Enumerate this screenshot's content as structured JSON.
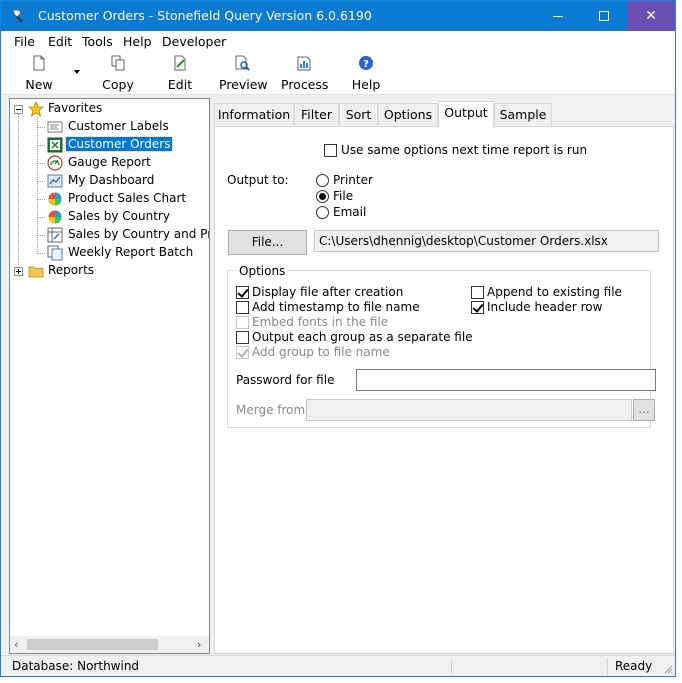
{
  "window": {
    "title": "Customer Orders - Stonefield Query Version 6.0.6190",
    "min_icon": "minimize-icon",
    "max_icon": "maximize-icon",
    "close_icon": "close-icon",
    "close_glyph": "✕"
  },
  "menu": [
    "File",
    "Edit",
    "Tools",
    "Help",
    "Developer"
  ],
  "toolbar": {
    "new": "New",
    "copy": "Copy",
    "edit": "Edit",
    "preview": "Preview",
    "process": "Process",
    "help": "Help"
  },
  "tree": {
    "favorites_label": "Favorites",
    "items": [
      {
        "label": "Customer Labels",
        "icon": "labels-report-icon"
      },
      {
        "label": "Customer Orders",
        "icon": "excel-report-icon",
        "selected": true
      },
      {
        "label": "Gauge Report",
        "icon": "gauge-icon"
      },
      {
        "label": "My Dashboard",
        "icon": "dashboard-icon"
      },
      {
        "label": "Product Sales Chart",
        "icon": "pie-chart-icon"
      },
      {
        "label": "Sales by Country",
        "icon": "pie-chart-icon"
      },
      {
        "label": "Sales by Country and Product",
        "icon": "crosstab-icon"
      },
      {
        "label": "Weekly Report Batch",
        "icon": "batch-icon"
      }
    ],
    "reports_label": "Reports",
    "scroll_left": "‹",
    "scroll_right": "›"
  },
  "tabs": [
    "Information",
    "Filter",
    "Sort",
    "Options",
    "Output",
    "Sample"
  ],
  "active_tab": "Output",
  "output": {
    "use_same_options": {
      "label": "Use same options next time report is run",
      "checked": false
    },
    "output_to_label": "Output to:",
    "destinations": [
      {
        "label": "Printer",
        "selected": false
      },
      {
        "label": "File",
        "selected": true
      },
      {
        "label": "Email",
        "selected": false
      }
    ],
    "file_button": "File...",
    "file_path": "C:\\Users\\dhennig\\desktop\\Customer Orders.xlsx",
    "options_group_title": "Options",
    "options_left": [
      {
        "label": "Display file after creation",
        "checked": true,
        "enabled": true
      },
      {
        "label": "Add timestamp to file name",
        "checked": false,
        "enabled": true
      },
      {
        "label": "Embed fonts in the file",
        "checked": false,
        "enabled": false
      },
      {
        "label": "Output each group as a separate file",
        "checked": false,
        "enabled": true
      },
      {
        "label": "Add group to file name",
        "checked": true,
        "enabled": false
      }
    ],
    "options_right": [
      {
        "label": "Append to existing file",
        "checked": false,
        "enabled": true
      },
      {
        "label": "Include header row",
        "checked": true,
        "enabled": true
      }
    ],
    "password_label": "Password for file",
    "password_value": "",
    "merge_label": "Merge from",
    "merge_value": "",
    "browse_label": "..."
  },
  "status": {
    "database": "Database: Northwind",
    "state": "Ready"
  },
  "colors": {
    "titlebar": "#0b7ad1",
    "close_hover": "#6a4eb3",
    "selection": "#0078d7"
  }
}
